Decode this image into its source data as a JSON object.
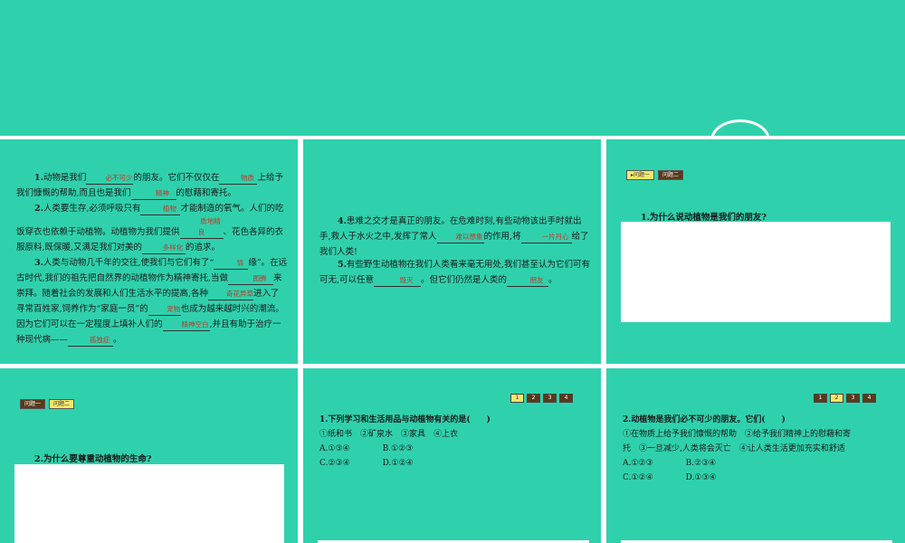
{
  "panel1": {
    "p1": {
      "num": "1.",
      "a": "动物是我们",
      "b1": "必不可少",
      "b": "的朋友。它们不仅仅在",
      "b2": "物质",
      "c": "上给予我们慷慨的帮助,而且也是我们",
      "b3": "精神",
      "d": "的慰藉和寄托。"
    },
    "p2": {
      "num": "2.",
      "a": "人类要生存,必须呼吸只有",
      "b1": "植物",
      "b": "才能制造的氧气。人们的吃饭穿衣也依赖于动植物。动植物为我们提供",
      "b2": "质地精良",
      "c": "、花色各异的衣服原料,既保暖,又满足我们对美的",
      "b3": "多样化",
      "d": "的追求。"
    },
    "p3": {
      "num": "3.",
      "a": "人类与动物几千年的交往,使我们与它们有了“",
      "b1": "情",
      "b": "缘”。在远古时代,我们的祖先把自然界的动植物作为精神寄托,当做",
      "b2": "图腾",
      "c": "来崇拜。随着社会的发展和人们生活水平的提高,各种",
      "b3": "奇花异草",
      "d": "进入了寻常百姓家,饲养作为“家庭一员”的",
      "b4": "宠物",
      "e": "也成为越来越时兴的潮流。因为它们可以在一定程度上填补人们的",
      "b5": "精神空白",
      "f": ",并且有助于治疗一种现代病——",
      "b6": "孤独症",
      "g": "。"
    }
  },
  "panel2": {
    "p4": {
      "num": "4.",
      "a": "患难之交才是真正的朋友。在危难时刻,有些动物该出手时就出手,救人于水火之中,发挥了常人",
      "b1": "难以想象",
      "b": "的作用,将",
      "b2": "一片丹心",
      "c": "给了我们人类!"
    },
    "p5": {
      "num": "5.",
      "a": "有些野生动植物在我们人类看来毫无用处,我们甚至认为它们可有可无,可以任意",
      "b1": "毁灭",
      "b": "。但它们仍然是人类的",
      "b2": "朋友",
      "c": "。"
    }
  },
  "panel3": {
    "tabs": [
      "▸问题一",
      "问题二"
    ],
    "question": "1.为什么说动植物是我们的朋友?"
  },
  "panel4": {
    "tabs": [
      "问题一",
      "问题二"
    ],
    "question": "2.为什么要尊重动植物的生命?"
  },
  "panel5": {
    "nums": [
      "1",
      "2",
      "3",
      "4"
    ],
    "q": "1.下列学习和生活用品与动植物有关的是(　　)",
    "opts": "①纸和书　②矿泉水　③家具　④上衣",
    "ab": "A.①③④　　　　B.①②③",
    "cd": "C.②③④　　　　D.①②④"
  },
  "panel6": {
    "nums": [
      "1",
      "2",
      "3",
      "4"
    ],
    "q": "2.动植物是我们必不可少的朋友。它们(　　)",
    "l1": "①在物质上给予我们慷慨的帮助　②给予我们精神上的慰藉和寄",
    "l2": "托　③一旦减少,人类将会灭亡　④让人类生活更加充实和舒适",
    "ab": "A.①②③　　　　B.②③④",
    "cd": "C.①②④　　　　D.①③④"
  }
}
